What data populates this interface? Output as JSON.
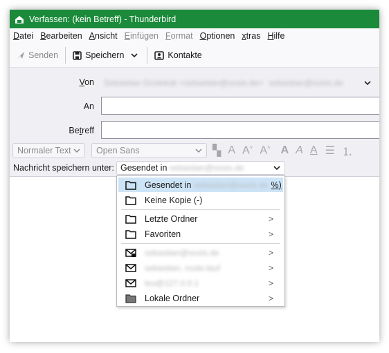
{
  "window": {
    "title": "Verfassen: (kein Betreff) - Thunderbird"
  },
  "menubar": {
    "items": [
      "Datei",
      "Bearbeiten",
      "Ansicht",
      "Einfügen",
      "Format",
      "Optionen",
      "Extras",
      "Hilfe"
    ]
  },
  "toolbar": {
    "send_label": "Senden",
    "save_label": "Speichern",
    "contacts_label": "Kontakte"
  },
  "header": {
    "from_label": "Von",
    "from_value": "Sebastian Grotekok <sebastian@sosis.de>",
    "from_alias": "sebastian@sosis.de",
    "to_label": "An",
    "to_value": "",
    "subject_label": "Betreff",
    "subject_value": ""
  },
  "format": {
    "paragraph_style": "Normaler Text",
    "font": "Open Sans"
  },
  "save": {
    "label": "Nachricht speichern unter:",
    "selected_prefix": "Gesendet in ",
    "selected_account": "sebastian@sosis.de"
  },
  "popup": {
    "items": [
      {
        "label": "Gesendet in ",
        "account": "sebastian@sosis.de",
        "suffix": "%)",
        "icon": "folder-icon",
        "highlighted": true,
        "submenu": false
      },
      {
        "label": "Keine Kopie (-)",
        "icon": "folder-icon",
        "submenu": false
      },
      {
        "label": "Letzte Ordner",
        "icon": "folder-icon",
        "submenu": true
      },
      {
        "label": "Favoriten",
        "icon": "folder-icon",
        "submenu": true
      },
      {
        "label": "sebastian@sosis.de",
        "icon": "mail-lock-icon",
        "submenu": true,
        "blurred": true
      },
      {
        "label": "sebastian, route-lauf",
        "icon": "mail-icon",
        "submenu": true,
        "blurred": true
      },
      {
        "label": "leo@127.0.0.1",
        "icon": "mail-icon",
        "submenu": true,
        "blurred": true
      },
      {
        "label": "Lokale Ordner",
        "icon": "local-folder-icon",
        "submenu": true
      }
    ]
  },
  "colors": {
    "titlebar": "#1b8a3a",
    "highlight": "#cde4f7"
  }
}
